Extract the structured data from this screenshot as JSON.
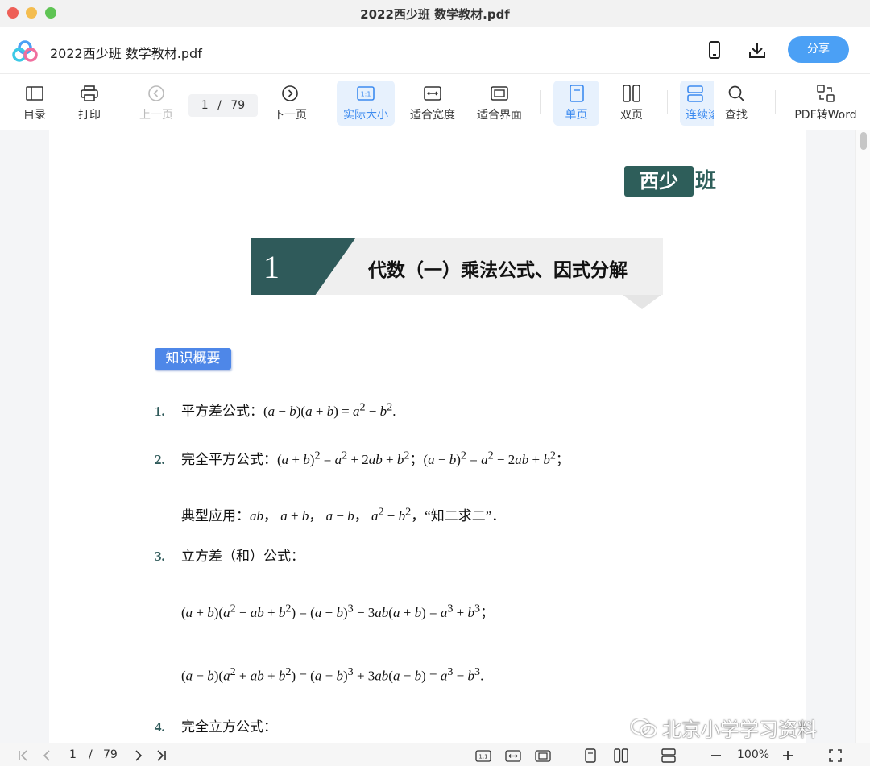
{
  "window": {
    "title": "2022西少班 数学教材.pdf"
  },
  "header": {
    "doc_title": "2022西少班 数学教材.pdf",
    "share_label": "分享",
    "icons": [
      "logo-icon",
      "phone-icon",
      "download-icon"
    ]
  },
  "toolbar": {
    "toc": "目录",
    "print": "打印",
    "prev": "上一页",
    "page_current": "1",
    "page_sep": "/",
    "page_total": "79",
    "next": "下一页",
    "actual_size": "实际大小",
    "fit_width": "适合宽度",
    "fit_page": "适合界面",
    "single": "单页",
    "double": "双页",
    "continuous": "连续滚",
    "find": "查找",
    "pdf_to_word": "PDF转Word",
    "accent": "#3d8bf0"
  },
  "page": {
    "brand": "西少",
    "brand_tail": "班",
    "chapter_num": "1",
    "chapter_title": "代数（一）乘法公式、因式分解",
    "tag": "知识概要",
    "items": [
      {
        "num": "1.",
        "label": "平方差公式："
      },
      {
        "num": "2.",
        "label": "完全平方公式："
      },
      {
        "text": "典型应用："
      },
      {
        "num": "3.",
        "label": "立方差（和）公式："
      },
      {
        "num": "4.",
        "label": "完全立方公式："
      }
    ],
    "quote": "，“知二求二”．"
  },
  "statusbar": {
    "page_current": "1",
    "page_sep": "/",
    "page_total": "79",
    "zoom": "100%"
  },
  "watermark": "北京小学学习资料"
}
